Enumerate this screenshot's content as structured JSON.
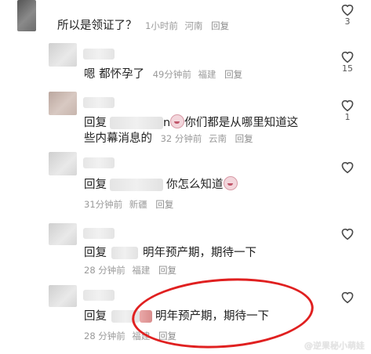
{
  "comments": [
    {
      "text": "所以是领证了？",
      "time": "1小时前",
      "location": "河南",
      "reply_label": "回复",
      "likes": "3"
    },
    {
      "text": "嗯 都怀孕了",
      "time": "49分钟前",
      "location": "福建",
      "reply_label": "回复",
      "likes": "15"
    },
    {
      "prefix": "回复",
      "name_tail": "n",
      "text": "你们都是从哪里知道这",
      "text_line2": "些内幕消息的",
      "time": "32 分钟前",
      "location": "云南",
      "reply_label": "回复",
      "likes": "1"
    },
    {
      "prefix": "回复",
      "text": "你怎么知道",
      "time": "31分钟前",
      "location": "新疆",
      "reply_label": "回复"
    },
    {
      "prefix": "回复",
      "text": "明年预产期，期待一下",
      "time": "28 分钟前",
      "location": "福建",
      "reply_label": "回复"
    },
    {
      "prefix": "回复",
      "text": "明年预产期，期待一下",
      "time": "28 分钟前",
      "location": "福建",
      "reply_label": "回复"
    }
  ],
  "watermark": "@逆果秘小萌娃",
  "colors": {
    "highlight": "#e02020",
    "meta": "#9a9a9a"
  },
  "icons": {
    "like": "heart-outline-icon"
  }
}
